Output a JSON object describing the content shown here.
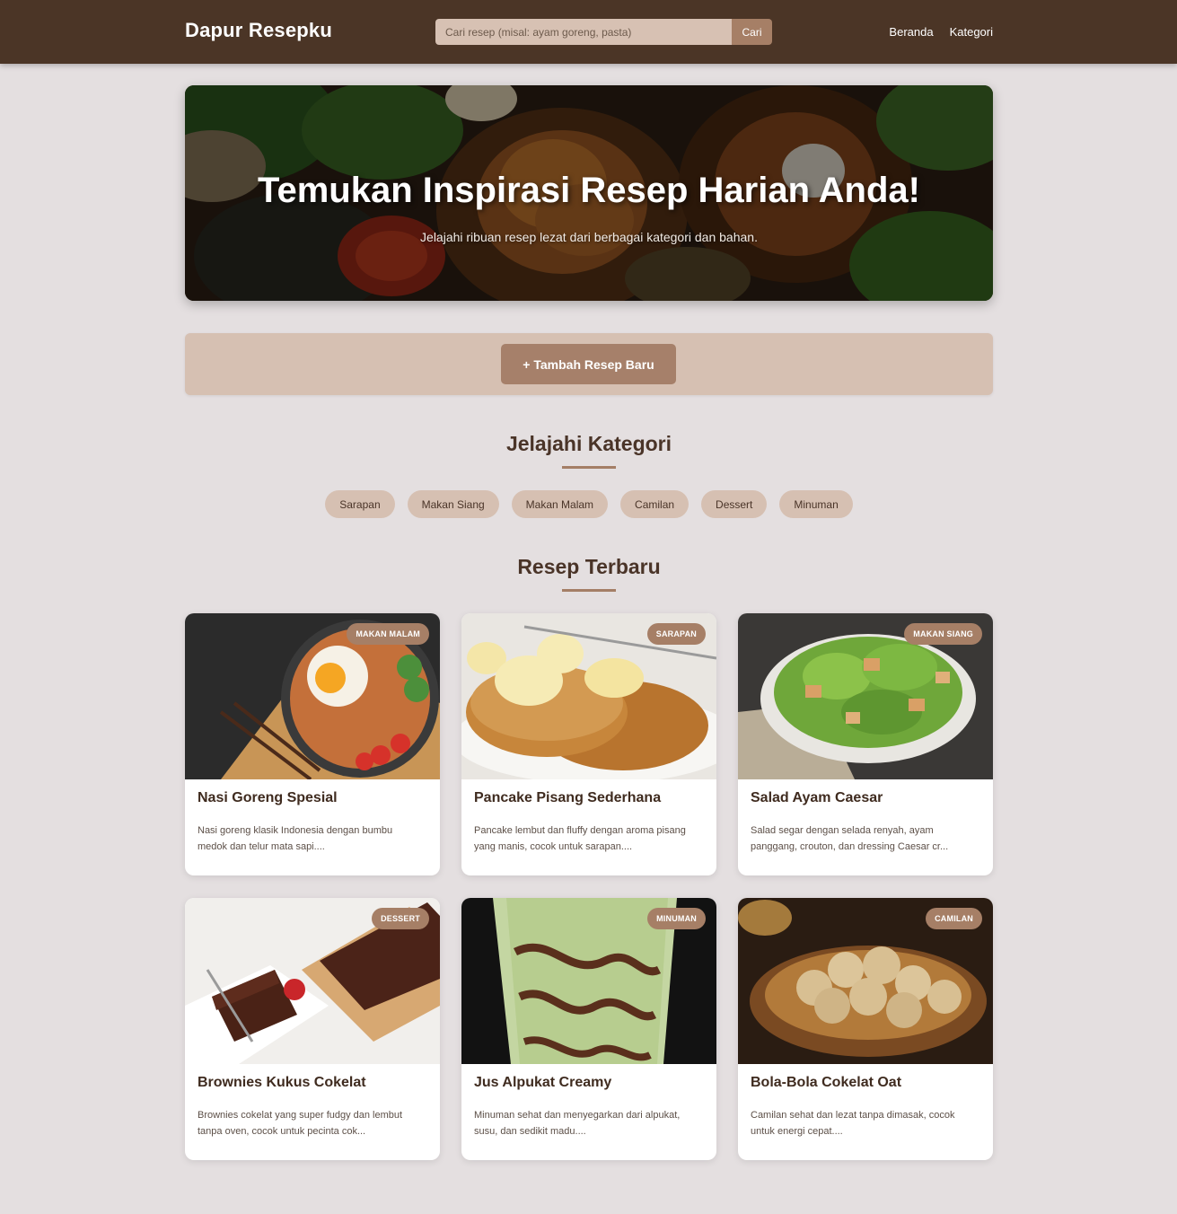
{
  "header": {
    "brand": "Dapur Resepku",
    "search": {
      "placeholder": "Cari resep (misal: ayam goreng, pasta)",
      "value": "",
      "button": "Cari"
    },
    "nav": [
      "Beranda",
      "Kategori"
    ]
  },
  "hero": {
    "title": "Temukan Inspirasi Resep Harian Anda!",
    "subtitle": "Jelajahi ribuan resep lezat dari berbagai kategori dan bahan."
  },
  "add_button": "+ Tambah Resep Baru",
  "categories_section": {
    "title": "Jelajahi Kategori",
    "items": [
      "Sarapan",
      "Makan Siang",
      "Makan Malam",
      "Camilan",
      "Dessert",
      "Minuman"
    ]
  },
  "recipes_section": {
    "title": "Resep Terbaru",
    "recipes": [
      {
        "title": "Nasi Goreng Spesial",
        "badge": "MAKAN MALAM",
        "description": "Nasi goreng klasik Indonesia dengan bumbu medok dan telur mata sapi....",
        "image": "fried-rice-photo"
      },
      {
        "title": "Pancake Pisang Sederhana",
        "badge": "SARAPAN",
        "description": "Pancake lembut dan fluffy dengan aroma pisang yang manis, cocok untuk sarapan....",
        "image": "banana-pancake-photo"
      },
      {
        "title": "Salad Ayam Caesar",
        "badge": "MAKAN SIANG",
        "description": "Salad segar dengan selada renyah, ayam panggang, crouton, dan dressing Caesar cr...",
        "image": "caesar-salad-photo"
      },
      {
        "title": "Brownies Kukus Cokelat",
        "badge": "DESSERT",
        "description": "Brownies cokelat yang super fudgy dan lembut tanpa oven, cocok untuk pecinta cok...",
        "image": "brownies-photo"
      },
      {
        "title": "Jus Alpukat Creamy",
        "badge": "MINUMAN",
        "description": "Minuman sehat dan menyegarkan dari alpukat, susu, dan sedikit madu....",
        "image": "avocado-juice-photo"
      },
      {
        "title": "Bola-Bola Cokelat Oat",
        "badge": "CAMILAN",
        "description": "Camilan sehat dan lezat tanpa dimasak, cocok untuk energi cepat....",
        "image": "oat-balls-photo"
      }
    ]
  },
  "colors": {
    "header_bg": "#4b3526",
    "page_bg": "#e4dfe0",
    "accent": "#a67f66",
    "light_accent": "#d6c0b2",
    "text_dark": "#4a3428"
  }
}
